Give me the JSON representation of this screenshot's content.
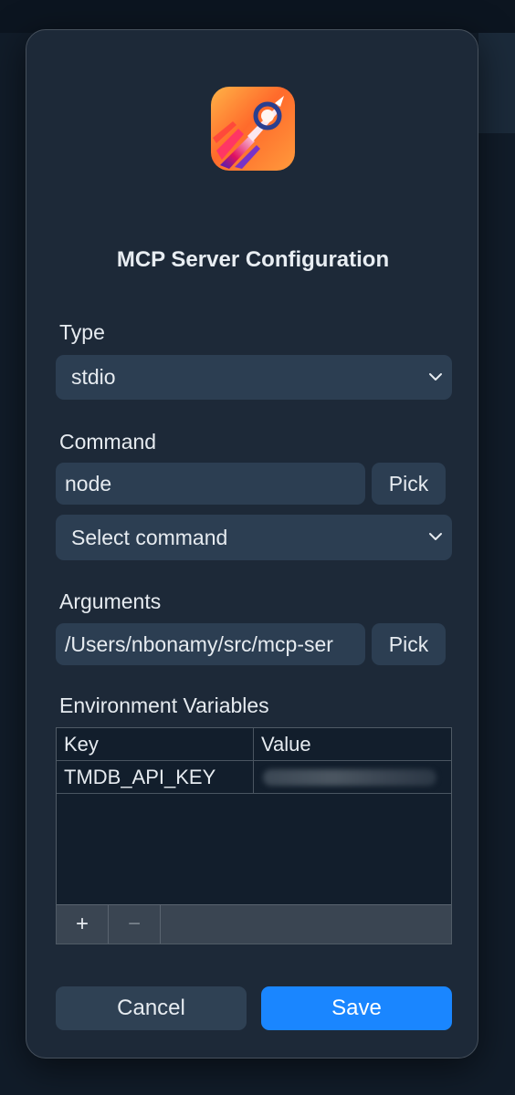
{
  "dialog": {
    "title": "MCP Server Configuration",
    "app_icon": "rocket-app-icon"
  },
  "type": {
    "label": "Type",
    "value": "stdio"
  },
  "command": {
    "label": "Command",
    "value": "node",
    "pick_label": "Pick",
    "select_placeholder": "Select command"
  },
  "arguments": {
    "label": "Arguments",
    "value": "/Users/nbonamy/src/mcp-ser",
    "pick_label": "Pick"
  },
  "env": {
    "label": "Environment Variables",
    "columns": [
      "Key",
      "Value"
    ],
    "rows": [
      {
        "key": "TMDB_API_KEY",
        "value_hidden": true
      }
    ],
    "add_label": "+",
    "remove_label": "−"
  },
  "actions": {
    "cancel_label": "Cancel",
    "save_label": "Save"
  },
  "colors": {
    "accent": "#1a86ff",
    "dialog_bg": "#1d2938",
    "control_bg": "#2c3e52"
  }
}
